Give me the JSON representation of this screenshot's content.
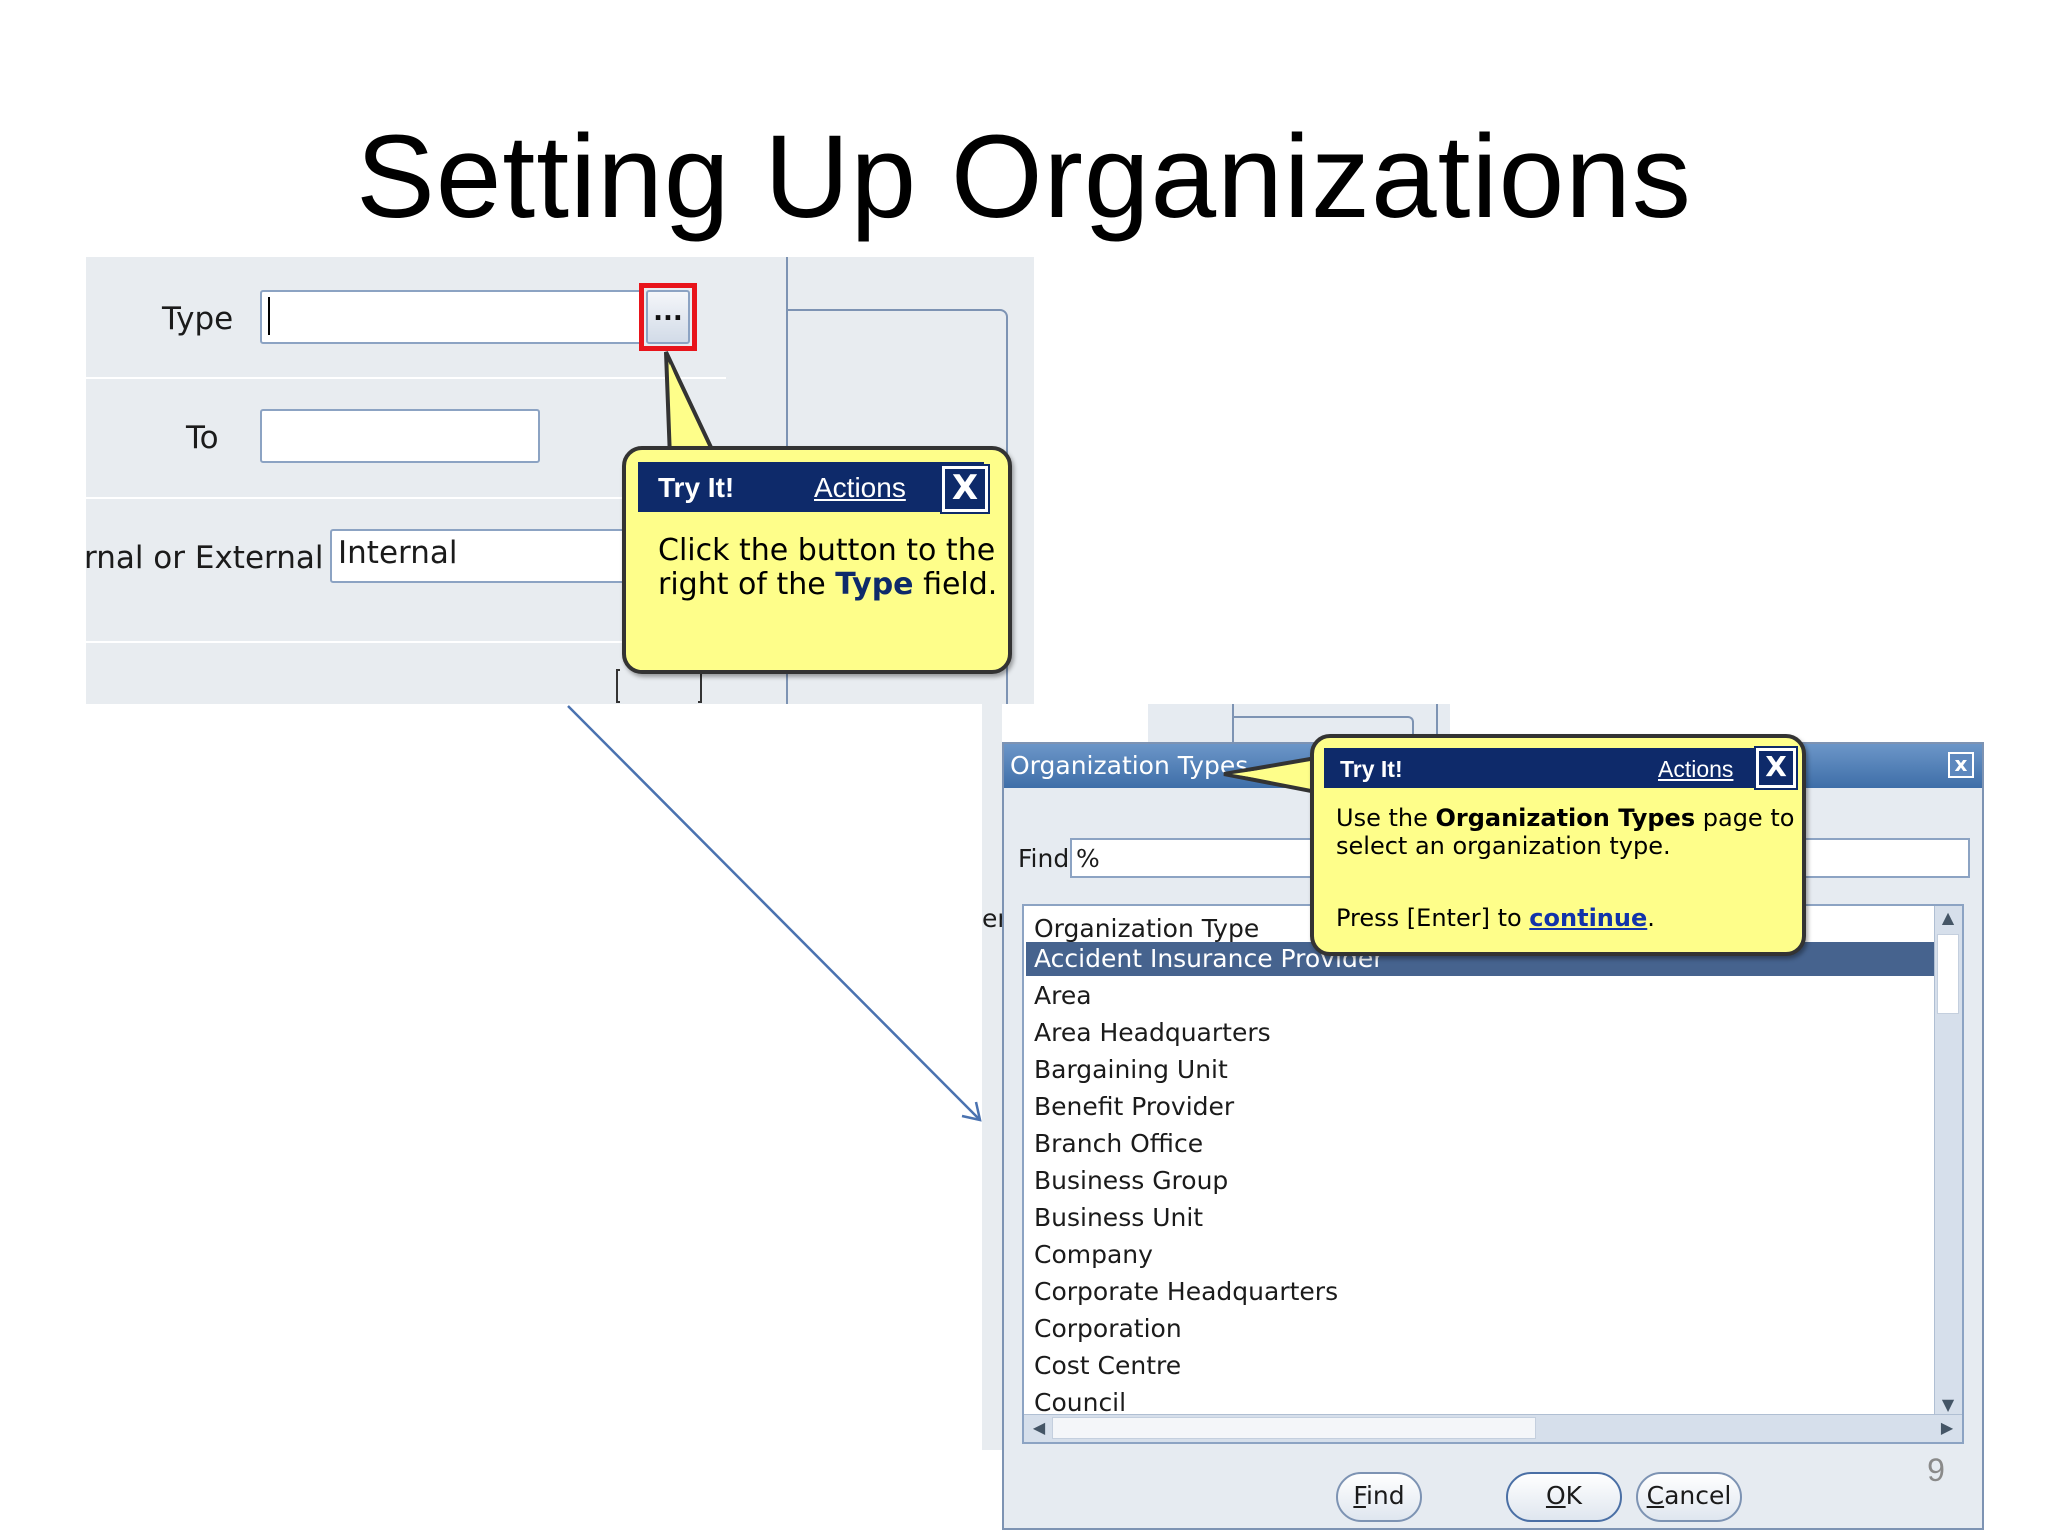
{
  "slide": {
    "title": "Setting Up Organizations",
    "page_number": "9"
  },
  "form": {
    "type_label": "Type",
    "type_value": "",
    "lov_button_label": "...",
    "to_label": "To",
    "to_value": "",
    "internal_external_label": "rnal or External",
    "internal_external_value": "Internal"
  },
  "bubble_1": {
    "header": "Try It!",
    "actions": "Actions",
    "close": "X",
    "text_part1": "Click the button to the right of the ",
    "text_bold": "Type",
    "text_part2": " field."
  },
  "dialog": {
    "title": "Organization Types",
    "close": "x",
    "find_label": "Find",
    "find_value": "%",
    "column_header": "Organization Type",
    "rows": [
      "Accident Insurance Provider",
      "Area",
      "Area Headquarters",
      "Bargaining Unit",
      "Benefit Provider",
      "Branch Office",
      "Business Group",
      "Business Unit",
      "Company",
      "Corporate Headquarters",
      "Corporation",
      "Cost Centre",
      "Council"
    ],
    "selected_index": 0,
    "buttons": {
      "find_acc": "F",
      "find_rest": "ind",
      "ok_acc": "O",
      "ok_rest": "K",
      "cancel_acc": "C",
      "cancel_rest": "ancel"
    },
    "left_cutoff_text": "er"
  },
  "bubble_2": {
    "header": "Try It!",
    "actions": "Actions",
    "close": "X",
    "line1_pre": "Use the ",
    "line1_bold": "Organization Types",
    "line1_post": " page to select an organization type.",
    "line2_pre": "Press [Enter] to ",
    "line2_link": "continue",
    "line2_post": "."
  },
  "colors": {
    "callout_yellow": "#fefe8a",
    "callout_header": "#0e2a6a",
    "highlight_red": "#e8141b",
    "selected_row": "#46638e",
    "titlebar": "#4f7fb8"
  }
}
